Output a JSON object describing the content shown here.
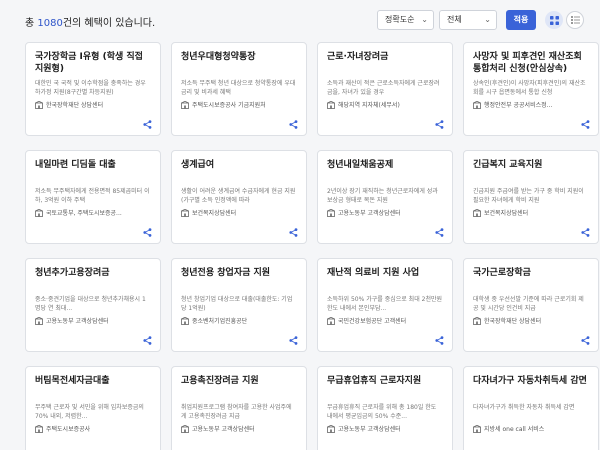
{
  "header": {
    "total_prefix": "총 ",
    "total_count": "1080",
    "total_suffix": "건의 혜택이 있습니다.",
    "sort_select": "정확도순",
    "category_select": "전체",
    "apply_label": "적용"
  },
  "icons": {
    "grid_view": "grid-view-icon",
    "list_view": "list-view-icon",
    "organization": "building-icon",
    "share": "share-icon"
  },
  "colors": {
    "accent": "#3a63d8",
    "count": "#2f55c9"
  },
  "cards": [
    {
      "title": "국가장학금 Ⅰ유형 (학생 직접지원형)",
      "desc": "대한민 국 국적 및 이수학점을 충족하는 경우 하가정 지원(8구간별 차등지원)",
      "org": "한국장학재단 상담센터"
    },
    {
      "title": "청년우대형청약통장",
      "desc": "저소득 무주택 청년 대상으로 청약통장에 우대금리 및 비과세 혜택",
      "org": "주택도시보증공사 기금지원처"
    },
    {
      "title": "근로·자녀장려금",
      "desc": "소득과 재산이 적은 근로소득자에게 근로장려금을, 자녀가 있을 경우",
      "org": "해당지역 지자체(세무서)"
    },
    {
      "title": "사망자 및 피후견인 재산조회 통합처리 신청(안심상속)",
      "desc": "상속인(후견인)이 사망자(피후견인)의 재산조회를 시구 읍면동에서 통합 신청",
      "org": "행정안전부 공공서비스정..."
    },
    {
      "title": "내일마련 디딤돌 대출",
      "desc": "저소득 무주택자에게 전용면적 85제곱미터 이하, 3억원 이하 주택",
      "org": "국토교통부, 주택도시보증공..."
    },
    {
      "title": "생계급여",
      "desc": "생활이 어려운 생계급여 수급자에게 현금 지원(가구별 소득 인정액에 따라",
      "org": "보건복지상담센터"
    },
    {
      "title": "청년내일채움공제",
      "desc": "2년이상 장기 재직하는 청년근로자에게 성과보상금 형태로 목돈 지원",
      "org": "고용노동부 고객상담센터"
    },
    {
      "title": "긴급복지 교육지원",
      "desc": "긴급지원 주급여를 받는 가구 중 학비 지원이 필요한 자녀에게 학비 지원",
      "org": "보건복지상담센터"
    },
    {
      "title": "청년추가고용장려금",
      "desc": "중소·중견기업을 대상으로 청년추가채용시 1명당 연 최대...",
      "org": "고용노동부 고객상담센터"
    },
    {
      "title": "청년전용 창업자금 지원",
      "desc": "청년 창업기업 대상으로 대출(대출한도: 기업당 1억원)",
      "org": "중소벤처기업진흥공단"
    },
    {
      "title": "재난적 의료비 지원 사업",
      "desc": "소득하위 50% 가구를 중심으로 최대 2천만원 한도 내에서 본인부담...",
      "org": "국민건강보험공단 고객센터"
    },
    {
      "title": "국가근로장학금",
      "desc": "대학생 중 우선선발 기준에 따라 근로기회 제공 및 시간당 인건비 지급",
      "org": "한국장학재단 상담센터"
    },
    {
      "title": "버팀목전세자금대출",
      "desc": "무주택 근로자 및 서민을 위해 임차보증금의 70% 내외, 저렴한...",
      "org": "주택도시보증공사"
    },
    {
      "title": "고용촉진장려금 지원",
      "desc": "취업지원프로그램 참여자를 고용한 사업주에게 고용촉진장려금 지급",
      "org": "고용노동부 고객상담센터"
    },
    {
      "title": "무급휴업휴직 근로자지원",
      "desc": "무급휴업휴직 근로자를 위해 총 180일 한도 내에서 평균임금의 50% 수준...",
      "org": "고용노동부 고객상담센터"
    },
    {
      "title": "다자녀가구 자동차취득세 감면",
      "desc": "다자녀가구가 취득한 자동차 취득세 감면",
      "org": "지방세 one call 서비스"
    }
  ]
}
